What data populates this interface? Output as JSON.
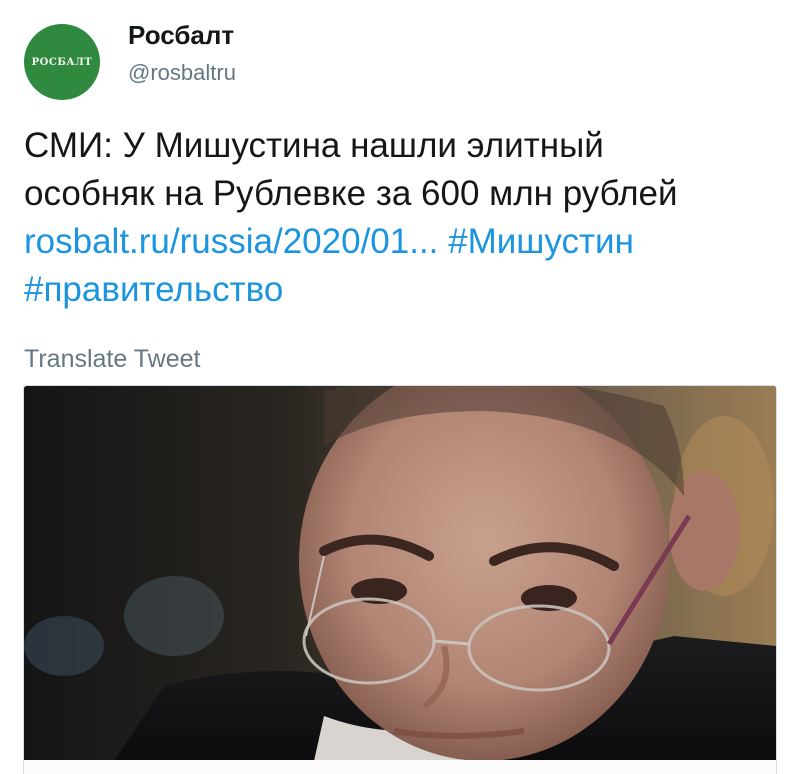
{
  "account": {
    "display_name": "Росбалт",
    "handle": "@rosbaltru",
    "avatar_text": "РОСБАЛТ",
    "avatar_color": "#2f8a3f"
  },
  "tweet": {
    "text_line1": "СМИ: У Мишустина нашли элитный",
    "text_line2": "особняк на Рублевке за 600 млн рублей",
    "link": "rosbalt.ru/russia/2020/01...",
    "hashtag1": "#Мишустин",
    "hashtag2": "#правительство",
    "translate_label": "Translate Tweet"
  },
  "colors": {
    "link": "#1b95e0",
    "secondary_text": "#657786"
  }
}
